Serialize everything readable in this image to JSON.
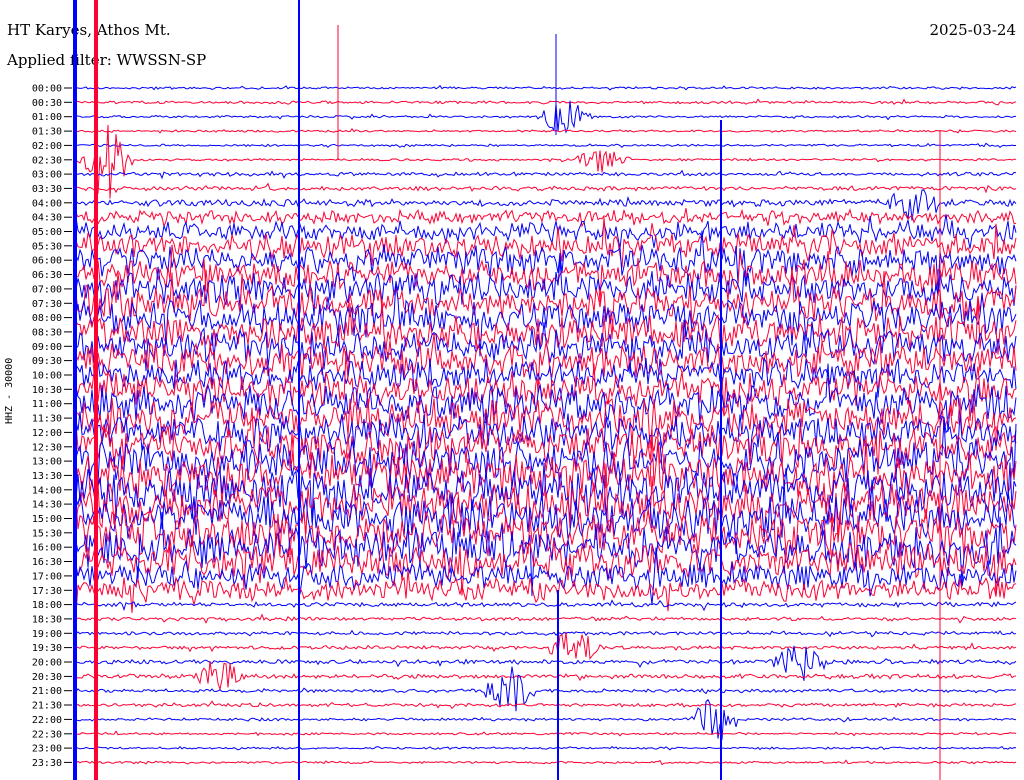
{
  "header": {
    "station": "HT Karyes, Athos Mt.",
    "filter": "Applied filter: WWSSN-SP",
    "date": "2025-03-24"
  },
  "y_axis_label": "HHZ - 30000",
  "colors": {
    "odd_trace": "#0000ff",
    "even_trace": "#ff0033",
    "background": "#ffffff"
  },
  "chart_data": {
    "type": "line",
    "title": "HT Karyes, Athos Mt.",
    "subtitle": "Applied filter: WWSSN-SP",
    "date": "2025-03-24",
    "ylabel": "HHZ - 30000",
    "row_labels": [
      "00:00",
      "00:30",
      "01:00",
      "01:30",
      "02:00",
      "02:30",
      "03:00",
      "03:30",
      "04:00",
      "04:30",
      "05:00",
      "05:30",
      "06:00",
      "06:30",
      "07:00",
      "07:30",
      "08:00",
      "08:30",
      "09:00",
      "09:30",
      "10:00",
      "10:30",
      "11:00",
      "11:30",
      "12:00",
      "12:30",
      "13:00",
      "13:30",
      "14:00",
      "14:30",
      "15:00",
      "15:30",
      "16:00",
      "16:30",
      "17:00",
      "17:30",
      "18:00",
      "18:30",
      "19:00",
      "19:30",
      "20:00",
      "20:30",
      "21:00",
      "21:30",
      "22:00",
      "22:30",
      "23:00",
      "23:30"
    ],
    "relative_noise_amplitude": [
      0.05,
      0.06,
      0.05,
      0.05,
      0.05,
      0.05,
      0.08,
      0.1,
      0.15,
      0.3,
      0.45,
      0.55,
      0.65,
      0.7,
      0.7,
      0.75,
      0.75,
      0.75,
      0.75,
      0.75,
      0.7,
      0.75,
      0.8,
      0.85,
      0.85,
      0.9,
      0.9,
      0.95,
      0.95,
      0.95,
      0.95,
      0.95,
      0.9,
      0.8,
      0.6,
      0.5,
      0.1,
      0.08,
      0.08,
      0.08,
      0.1,
      0.1,
      0.08,
      0.08,
      0.06,
      0.05,
      0.05,
      0.05
    ],
    "events": [
      {
        "row": "01:00",
        "x_frac": 0.52,
        "amplitude": 0.8
      },
      {
        "row": "02:30",
        "x_frac": 0.56,
        "amplitude": 0.6
      },
      {
        "row": "02:30",
        "x_frac": 0.03,
        "amplitude": 2.2
      },
      {
        "row": "04:00",
        "x_frac": 0.89,
        "amplitude": 0.7
      },
      {
        "row": "19:30",
        "x_frac": 0.53,
        "amplitude": 0.9
      },
      {
        "row": "20:00",
        "x_frac": 0.77,
        "amplitude": 0.9
      },
      {
        "row": "20:30",
        "x_frac": 0.15,
        "amplitude": 0.8
      },
      {
        "row": "21:00",
        "x_frac": 0.46,
        "amplitude": 1.0
      },
      {
        "row": "22:00",
        "x_frac": 0.68,
        "amplitude": 1.0
      }
    ],
    "grid": false,
    "legend": "none"
  }
}
